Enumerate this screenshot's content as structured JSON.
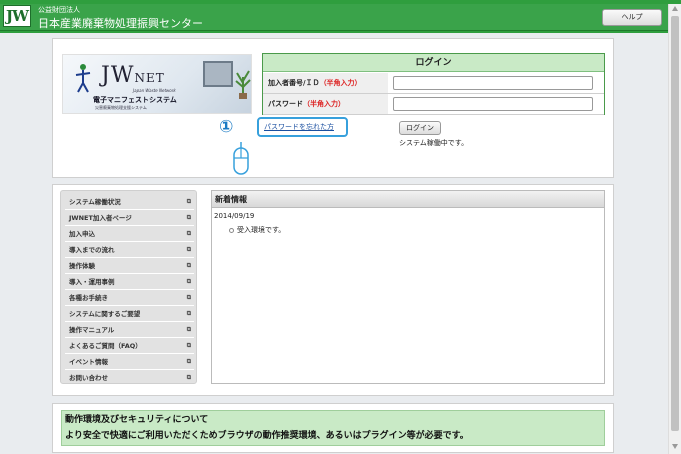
{
  "header": {
    "logo": "JW",
    "org_type": "公益財団法人",
    "org_name": "日本産業廃棄物処理振興センター",
    "help_label": "ヘルプ"
  },
  "banner": {
    "brand": "JW",
    "brand_suffix": "NET",
    "tagline_en": "Japan Waste Network",
    "title_jp": "電子マニフェストシステム",
    "subtitle_jp": "災害廃棄物処理支援システム"
  },
  "login": {
    "title": "ログイン",
    "id_label": "加入者番号/ＩＤ",
    "id_note": "（半角入力）",
    "password_label": "パスワード",
    "password_note": "（半角入力）",
    "id_value": "",
    "password_value": "",
    "forgot_link": "パスワードを忘れた方",
    "login_button": "ログイン",
    "system_status": "システム稼働中です。"
  },
  "annotation": {
    "step_marker": "①"
  },
  "menu": {
    "items": [
      {
        "label": "システム稼働状況"
      },
      {
        "label": "JWNET加入者ページ"
      },
      {
        "label": "加入申込"
      },
      {
        "label": "導入までの流れ"
      },
      {
        "label": "操作体験"
      },
      {
        "label": "導入・運用事例"
      },
      {
        "label": "各種お手続き"
      },
      {
        "label": "システムに関するご要望"
      },
      {
        "label": "操作マニュアル"
      },
      {
        "label": "よくあるご質問（FAQ）"
      },
      {
        "label": "イベント情報"
      },
      {
        "label": "お問い合わせ"
      }
    ]
  },
  "news": {
    "title": "新着情報",
    "date": "2014/09/19",
    "item": "受入環境です。"
  },
  "environment": {
    "title": "動作環境及びセキュリティについて",
    "subtitle": "より安全で快適にご利用いただくためブラウザの動作推奨環境、あるいはプラグイン等が必要です。"
  }
}
